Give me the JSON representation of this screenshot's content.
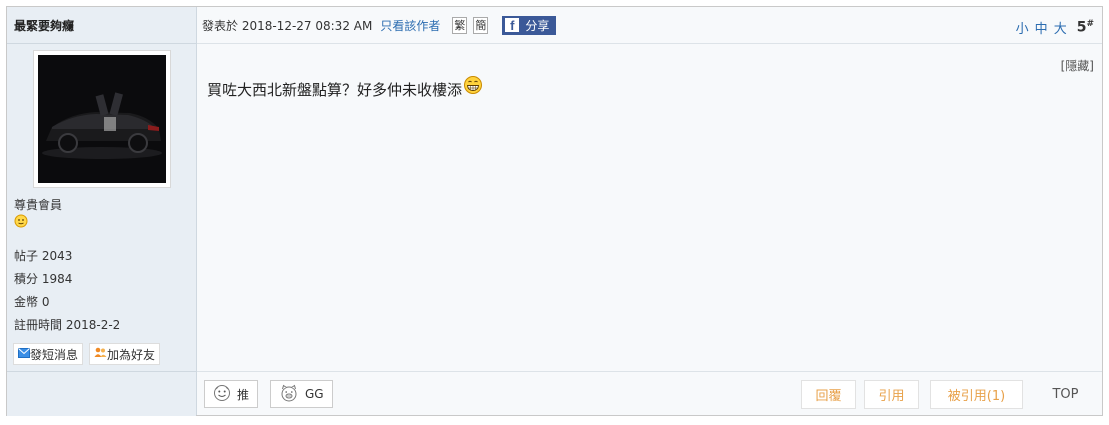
{
  "user": {
    "name": "最緊要夠癮",
    "rank": "尊貴會員",
    "stats": [
      {
        "label": "帖子",
        "value": "2043"
      },
      {
        "label": "積分",
        "value": "1984"
      },
      {
        "label": "金幣",
        "value": "0"
      },
      {
        "label": "註冊時間",
        "value": "2018-2-2"
      }
    ],
    "pm_label": "發短消息",
    "friend_label": "加為好友"
  },
  "post": {
    "posted_label": "發表於 2018-12-27 08:32 AM",
    "only_author": "只看該作者",
    "trad": "繁",
    "simp": "簡",
    "share_label": "分享",
    "font_small": "小",
    "font_medium": "中",
    "font_large": "大",
    "floor": "5",
    "floor_mark": "#",
    "hide_label": "[隱藏]",
    "content": "買咗大西北新盤點算？好多仲未收樓添"
  },
  "footer": {
    "push_label": "推",
    "gg_label": "GG",
    "reply_label": "回覆",
    "quote_label": "引用",
    "quoted_label": "被引用(1)",
    "top_label": "TOP"
  },
  "colors": {
    "accent": "#e8a14a",
    "link": "#2b6cb0",
    "facebook": "#3b5998"
  }
}
